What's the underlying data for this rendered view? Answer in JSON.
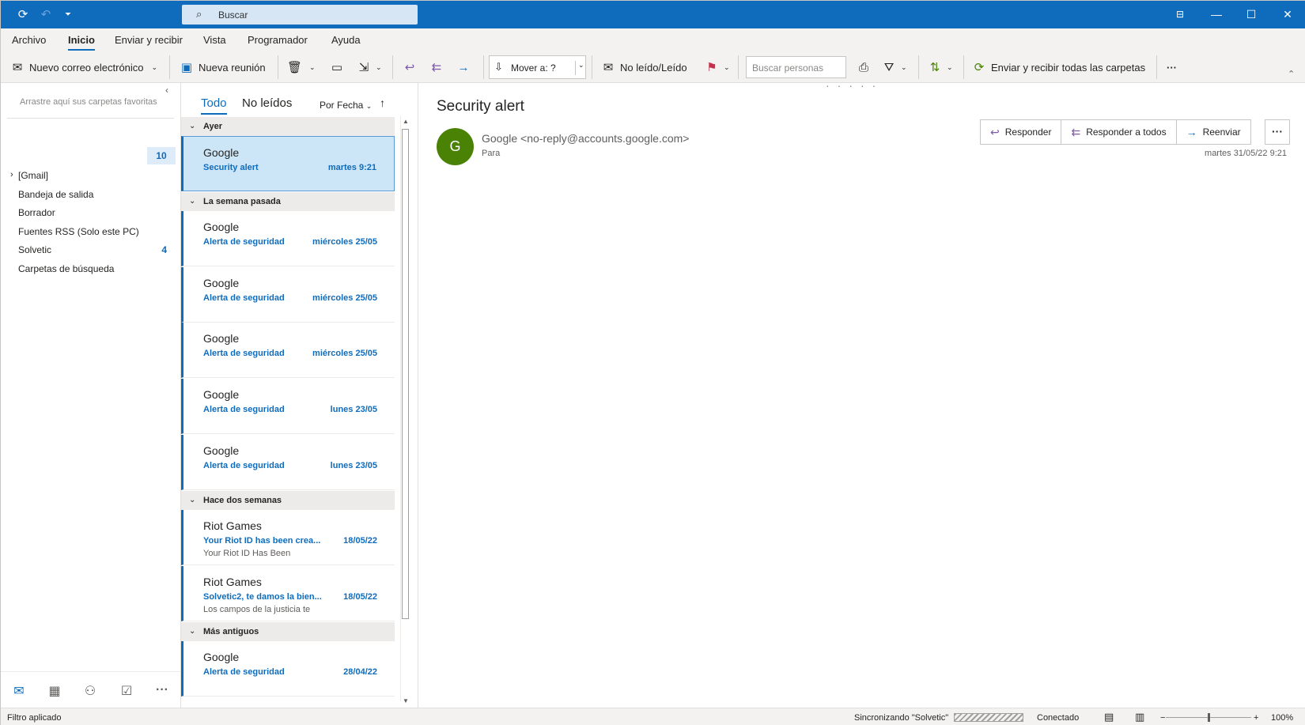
{
  "titlebar": {
    "search_placeholder": "Buscar"
  },
  "menu": {
    "tabs": [
      "Archivo",
      "Inicio",
      "Enviar y recibir",
      "Vista",
      "Programador",
      "Ayuda"
    ],
    "active": "Inicio"
  },
  "ribbon": {
    "new_mail": "Nuevo correo electrónico",
    "new_meeting": "Nueva reunión",
    "move_to": "Mover a: ?",
    "unread_read": "No leído/Leído",
    "search_people_placeholder": "Buscar personas",
    "send_receive_all": "Enviar y recibir todas las carpetas",
    "more": "···"
  },
  "folders": {
    "favorites_hint": "Arrastre aquí sus carpetas favoritas",
    "inbox_unread": "10",
    "items": [
      {
        "label": "[Gmail]"
      },
      {
        "label": "Bandeja de salida"
      },
      {
        "label": "Borrador"
      },
      {
        "label": "Fuentes RSS (Solo este PC)"
      },
      {
        "label": "Solvetic",
        "count": "4"
      },
      {
        "label": "Carpetas de búsqueda"
      }
    ]
  },
  "list": {
    "filters": [
      "Todo",
      "No leídos"
    ],
    "sort_label": "Por Fecha",
    "groups": [
      "Ayer",
      "La semana pasada",
      "Hace dos semanas",
      "Más antiguos"
    ],
    "mails": [
      {
        "sender": "Google",
        "subject": "Security alert",
        "date": "martes 9:21",
        "preview": ""
      },
      {
        "sender": "Google",
        "subject": "Alerta de seguridad",
        "date": "miércoles 25/05",
        "preview": ""
      },
      {
        "sender": "Google",
        "subject": "Alerta de seguridad",
        "date": "miércoles 25/05",
        "preview": ""
      },
      {
        "sender": "Google",
        "subject": "Alerta de seguridad",
        "date": "miércoles 25/05",
        "preview": ""
      },
      {
        "sender": "Google",
        "subject": "Alerta de seguridad",
        "date": "lunes 23/05",
        "preview": ""
      },
      {
        "sender": "Google",
        "subject": "Alerta de seguridad",
        "date": "lunes 23/05",
        "preview": ""
      },
      {
        "sender": "Riot Games",
        "subject": "Your Riot ID has been crea...",
        "date": "18/05/22",
        "preview": "Your Riot ID Has Been"
      },
      {
        "sender": "Riot Games",
        "subject": "Solvetic2, te damos la bien...",
        "date": "18/05/22",
        "preview": "Los campos de la justicia te"
      },
      {
        "sender": "Google",
        "subject": "Alerta de seguridad",
        "date": "28/04/22",
        "preview": ""
      }
    ]
  },
  "reading": {
    "subject": "Security alert",
    "avatar_letter": "G",
    "from": "Google <no-reply@accounts.google.com>",
    "to_label": "Para",
    "reply": "Responder",
    "reply_all": "Responder a todos",
    "forward": "Reenviar",
    "date": "martes 31/05/22 9:21"
  },
  "status": {
    "filter": "Filtro aplicado",
    "sync": "Sincronizando \"Solvetic\"",
    "connection": "Conectado",
    "zoom": "100%"
  },
  "colors": {
    "accent": "#0f6cbd",
    "avatar": "#498205",
    "reply_icon": "#7f5aa8"
  }
}
